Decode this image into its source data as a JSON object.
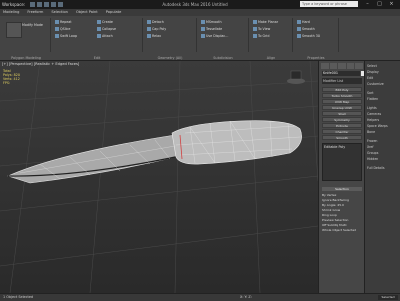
{
  "titlebar": {
    "app_button": "Workspace: Default",
    "title": "Autodesk 3ds Max 2016   Untitled",
    "search_placeholder": "Type a keyword or phrase"
  },
  "menubar": {
    "items": [
      "Modeling",
      "Freeform",
      "Selection",
      "Object Paint",
      "Populate"
    ]
  },
  "ribbon": {
    "groups": [
      "Polygon Modeling",
      "Edit",
      "Geometry (All)",
      "Subdivision",
      "Align",
      "Properties"
    ],
    "items": [
      "Repeat",
      "QSlice",
      "Swift Loop",
      "Create",
      "Collapse",
      "Attach",
      "Detach",
      "Cap Poly",
      "Relax",
      "MSmooth",
      "Tessellate",
      "Use Displac...",
      "Make Planar",
      "To View",
      "To Grid",
      "Hard",
      "Smooth",
      "Smooth 30"
    ],
    "modify_mode": "Modify Mode"
  },
  "viewport": {
    "label": "[+] [Perspective] [Realistic + Edged Faces]",
    "stats": [
      "Total",
      "Polys: 820",
      "Verts: 412",
      "FPS:"
    ]
  },
  "command_panel": {
    "object_name": "Knife001",
    "modifier_list": "Modifier List",
    "buttons": [
      "Edit Poly",
      "Turbo Smooth",
      "UVW Map",
      "Unwrap UVW",
      "Shell",
      "Symmetry",
      "Extrude",
      "Chamfer",
      "Smooth",
      "Edit Mesh"
    ],
    "stack_item": "Editable Poly",
    "rollout_title": "Selection",
    "rollout_items": [
      "By Vertex",
      "Ignore Backfacing",
      "By Angle: 45.0",
      "Shrink  Grow",
      "Ring  Loop",
      "Preview Selection",
      "Off  SubObj  Multi",
      "Whole Object Selected"
    ]
  },
  "side_panel": {
    "items": [
      "Select",
      "Display",
      "Edit",
      "Customize",
      "Sort",
      "Flatten",
      "Lights",
      "Cameras",
      "Helpers",
      "Space Warps",
      "Bone",
      "Frozen",
      "Xref",
      "Groups",
      "Hidden",
      "Full Details"
    ]
  },
  "status": {
    "text": "1 Object Selected",
    "coords": "X: Y: Z:",
    "selected_label": "Selected"
  },
  "colors": {
    "mesh_fill": "#bdbdbd",
    "mesh_edge": "#e8e8e8",
    "accent": "#6a8fb0"
  }
}
